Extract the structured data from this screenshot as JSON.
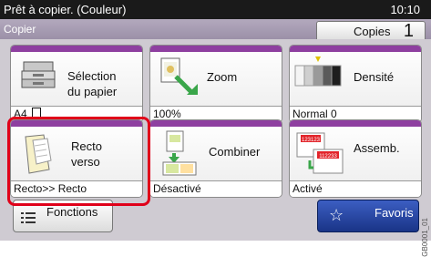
{
  "status": {
    "text": "Prêt à copier. (Couleur)",
    "time": "10:10"
  },
  "title": {
    "text": "Copier",
    "copies_label": "Copies",
    "copies_value": "1"
  },
  "tiles": {
    "paper": {
      "label_line1": "Sélection",
      "label_line2": "du papier",
      "value": "A4"
    },
    "zoom": {
      "label": "Zoom",
      "value": "100%"
    },
    "density": {
      "label": "Densité",
      "value": "Normal 0"
    },
    "duplex": {
      "label_line1": "Recto",
      "label_line2": "verso",
      "value": "Recto>> Recto"
    },
    "combine": {
      "label": "Combiner",
      "value": "Désactivé"
    },
    "collate": {
      "label": "Assemb.",
      "value": "Activé"
    }
  },
  "bottom": {
    "functions_label": "Fonctions",
    "favorites_label": "Favoris"
  },
  "watermark": "GB0001_01",
  "colors": {
    "accent": "#8e3fa0",
    "highlight": "#e0001a",
    "favorites": "#1a3487"
  },
  "icons": [
    "paper-tray-icon",
    "zoom-icon",
    "density-icon",
    "duplex-icon",
    "combine-icon",
    "collate-icon",
    "functions-list-icon",
    "star-icon",
    "paper-orientation-icon"
  ]
}
